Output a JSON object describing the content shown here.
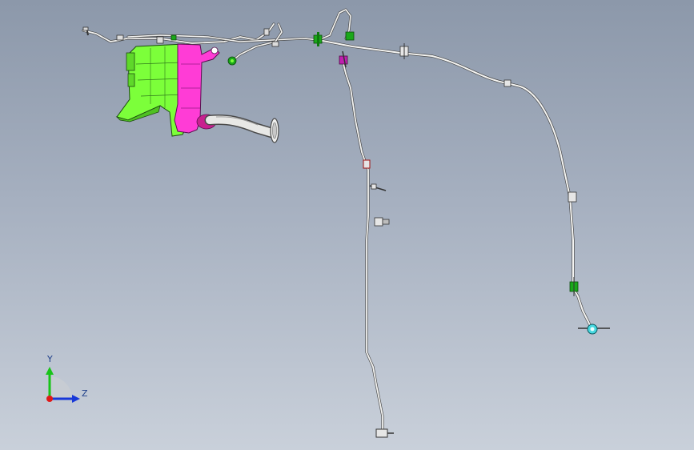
{
  "viewport": {
    "triad": {
      "y_label": "Y",
      "z_label": "Z"
    }
  },
  "colors": {
    "bg_top": "#8c98aa",
    "bg_bottom": "#c9d0da",
    "tank_green": "#7cff3a",
    "pump_magenta": "#ff3cd6",
    "hose": "#f4f4f2",
    "hose_edge": "#4a4a4a",
    "clip_green": "#1aa81a",
    "clip_cyan": "#46d8e0",
    "axis_y": "#18c418",
    "axis_z": "#1838d8",
    "axis_x": "#e01818"
  }
}
